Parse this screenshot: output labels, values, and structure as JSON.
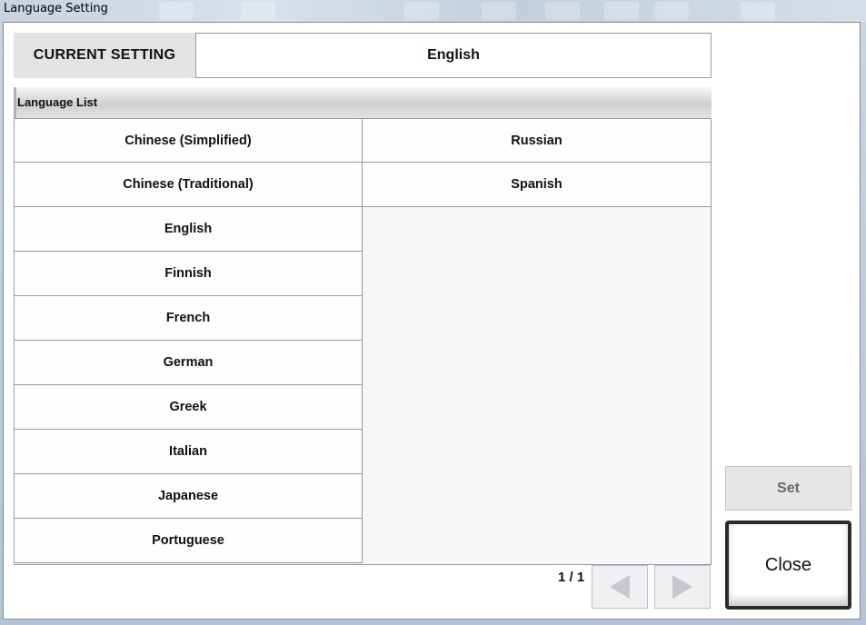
{
  "window": {
    "title": "Language Setting"
  },
  "current": {
    "label": "CURRENT SETTING",
    "value": "English"
  },
  "list": {
    "header": "Language List",
    "left": [
      "Chinese (Simplified)",
      "Chinese (Traditional)",
      "English",
      "Finnish",
      "French",
      "German",
      "Greek",
      "Italian",
      "Japanese",
      "Portuguese"
    ],
    "right": [
      "Russian",
      "Spanish"
    ]
  },
  "pager": {
    "text": "1 / 1"
  },
  "buttons": {
    "set": "Set",
    "close": "Close"
  },
  "icons": {
    "prev": "triangle-left-icon",
    "next": "triangle-right-icon"
  }
}
